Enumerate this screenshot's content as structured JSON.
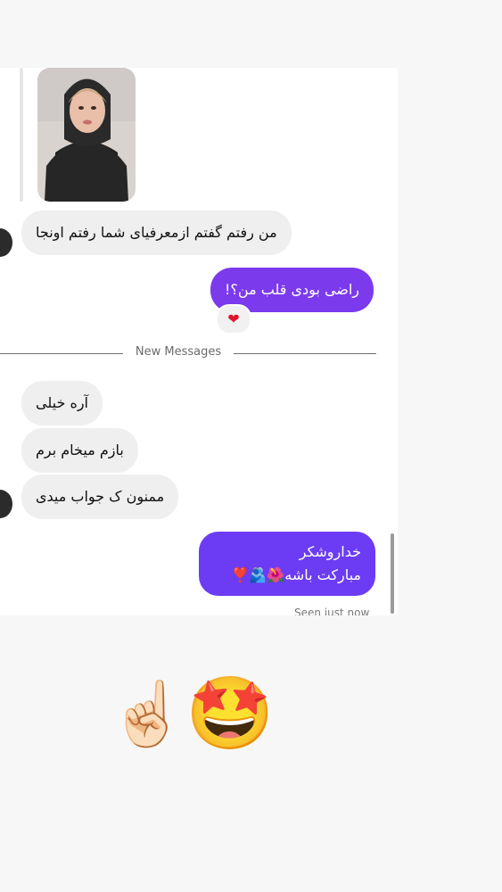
{
  "chat": {
    "messages_incoming_1": "من رفتم گفتم ازمعرفیای شما رفتم اونجا",
    "message_outgoing_1": "راضی بودی قلب من؟!",
    "reaction": "❤",
    "divider_label": "New Messages",
    "incoming_after": [
      "آره خیلی",
      "بازم میخام برم",
      "ممنون ک جواب میدی"
    ],
    "outgoing_final_line1": "خداروشکر",
    "outgoing_final_line2": "مبارکت باشه🌺🫂❣️",
    "seen_label": "Seen just now"
  },
  "overlay": {
    "pointer_emoji": "☝🏻",
    "star_eyes_emoji": "🤩"
  }
}
